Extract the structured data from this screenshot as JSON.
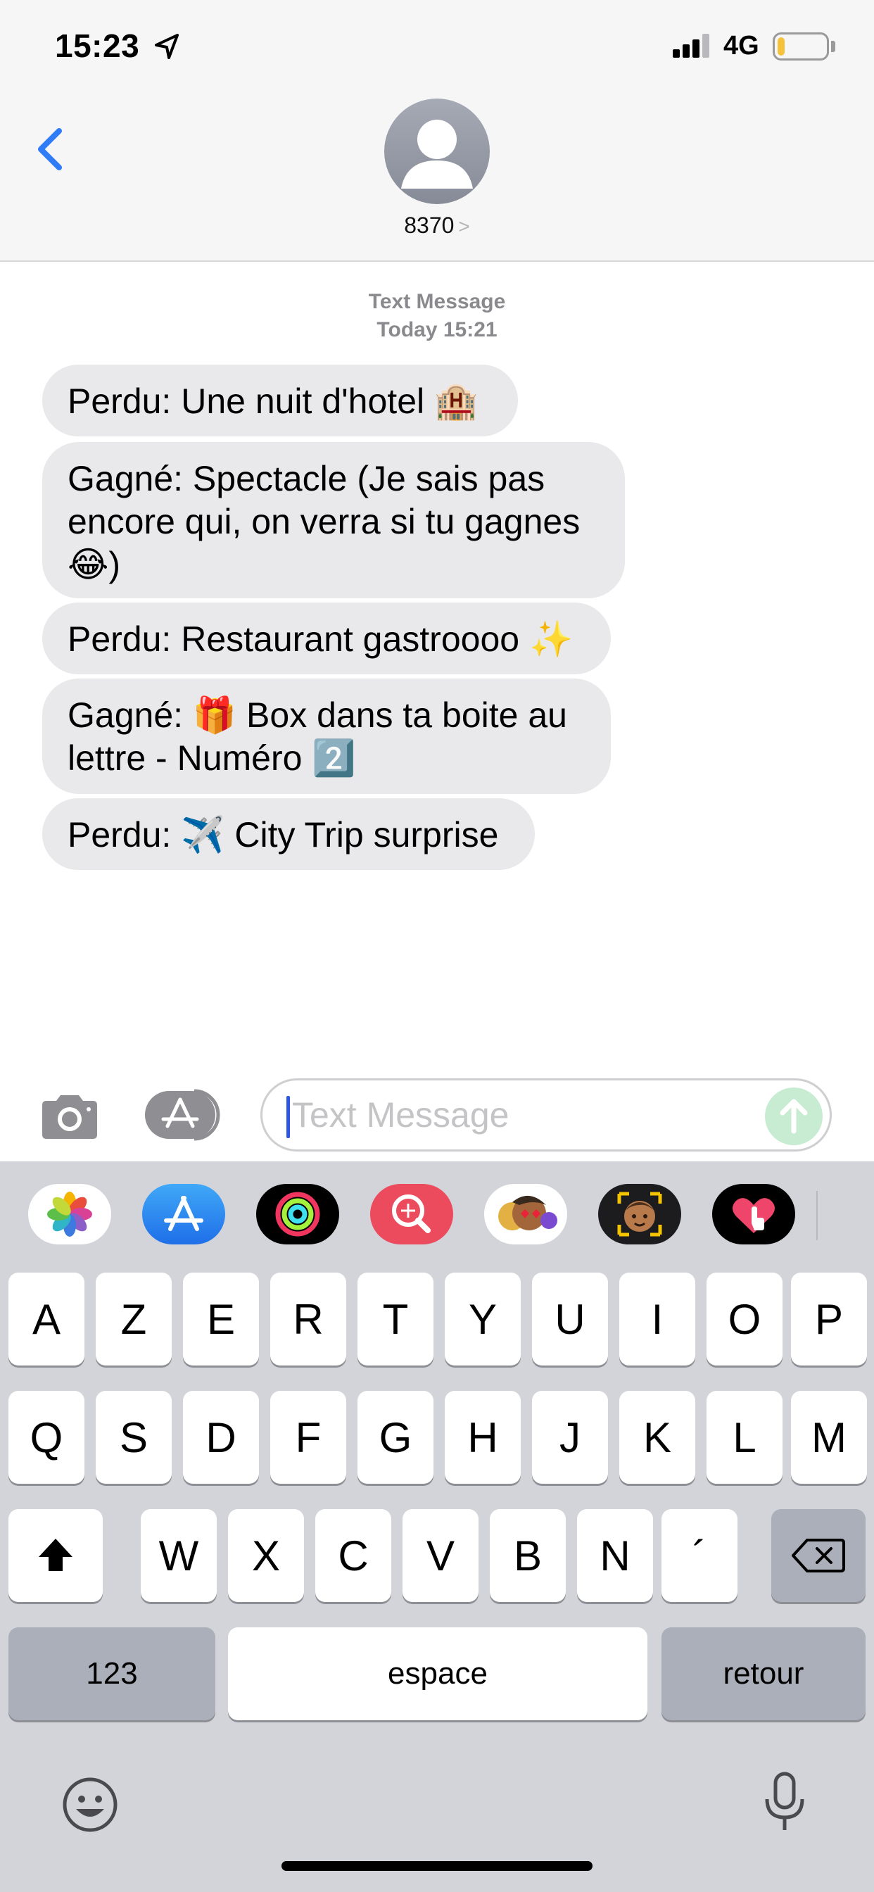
{
  "status_bar": {
    "time": "15:23",
    "network": "4G",
    "battery_level": 0.15,
    "colors": {
      "battery_fill": "#f5c33b"
    }
  },
  "header": {
    "back_icon": "chevron-left-icon",
    "contact_name": "8370",
    "avatar_icon": "person-icon",
    "accent_color": "#2f7cf6"
  },
  "conversation": {
    "type_label": "Text Message",
    "timestamp": "Today 15:21",
    "messages": [
      {
        "text": "Perdu: Une nuit d'hotel 🏨"
      },
      {
        "text": "Gagné: Spectacle (Je sais pas encore qui, on verra si tu gagnes 😂)"
      },
      {
        "text": "Perdu: Restaurant gastroooo ✨"
      },
      {
        "text": "Gagné: 🎁 Box dans ta boite au lettre - Numéro 2️⃣"
      },
      {
        "text": "Perdu: ✈️ City Trip surprise"
      }
    ]
  },
  "compose": {
    "placeholder": "Text Message",
    "camera_icon": "camera-icon",
    "apps_icon": "app-store-icon",
    "send_icon": "send-arrow-icon"
  },
  "app_strip": {
    "apps": [
      "photos-icon",
      "app-store-icon",
      "activity-icon",
      "image-search-icon",
      "memoji-stickers-icon",
      "memoji-icon",
      "digital-touch-icon"
    ]
  },
  "keyboard": {
    "row1": [
      "A",
      "Z",
      "E",
      "R",
      "T",
      "Y",
      "U",
      "I",
      "O",
      "P"
    ],
    "row2": [
      "Q",
      "S",
      "D",
      "F",
      "G",
      "H",
      "J",
      "K",
      "L",
      "M"
    ],
    "row3": [
      "W",
      "X",
      "C",
      "V",
      "B",
      "N",
      "´"
    ],
    "numbers_label": "123",
    "space_label": "espace",
    "return_label": "retour",
    "shift_icon": "shift-icon",
    "delete_icon": "delete-icon",
    "emoji_icon": "emoji-icon",
    "mic_icon": "microphone-icon"
  }
}
